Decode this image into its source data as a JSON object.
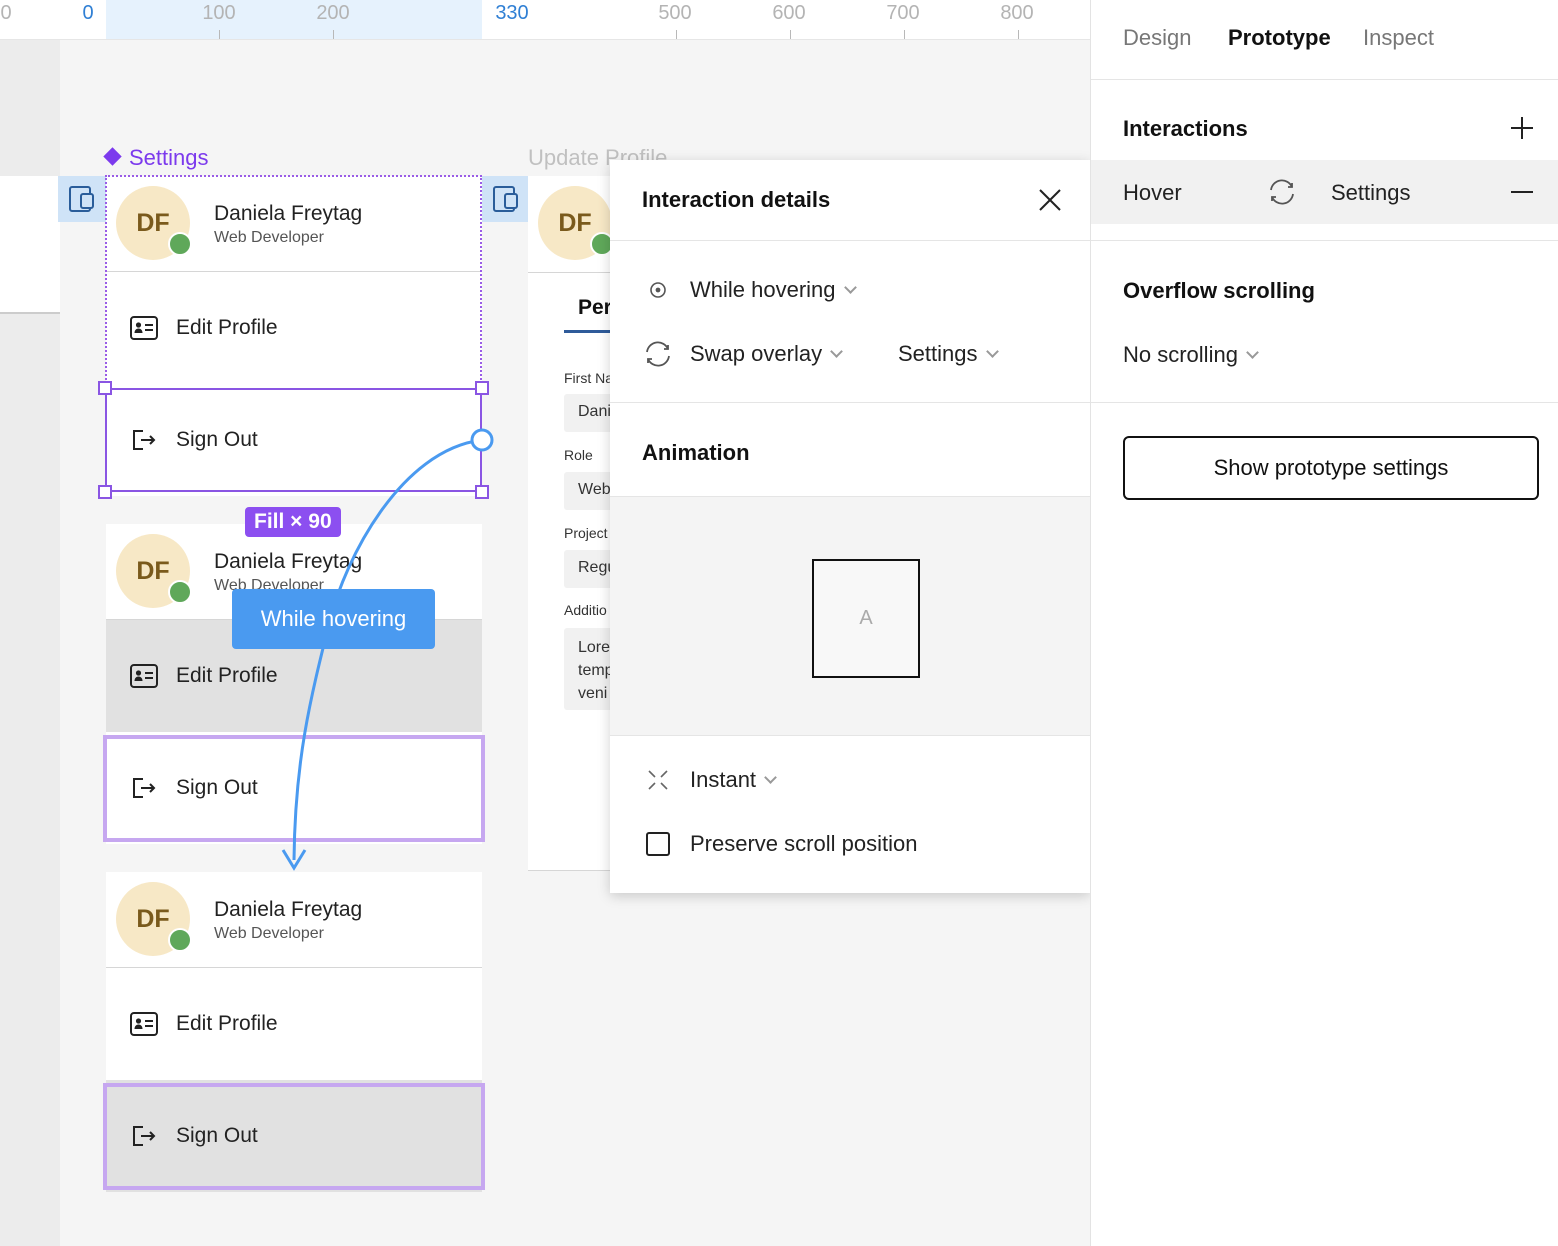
{
  "ruler": {
    "labels": [
      "0",
      "100",
      "200",
      "330",
      "500",
      "600",
      "700",
      "800"
    ],
    "selection_start": "0",
    "selection_end": "330"
  },
  "canvas": {
    "settings_frame_label": "Settings",
    "update_frame_label": "Update Profile",
    "fill_badge": "Fill × 90",
    "hover_badge": "While hovering"
  },
  "cards": [
    {
      "initials": "DF",
      "name": "Daniela Freytag",
      "role": "Web Developer",
      "edit": "Edit Profile",
      "signout": "Sign Out"
    },
    {
      "initials": "DF",
      "name": "Daniela Freytag",
      "role": "Web Developer",
      "edit": "Edit Profile",
      "signout": "Sign Out"
    },
    {
      "initials": "DF",
      "name": "Daniela Freytag",
      "role": "Web Developer",
      "edit": "Edit Profile",
      "signout": "Sign Out"
    }
  ],
  "update_profile": {
    "initials": "DF",
    "tab": "Per",
    "fields": [
      {
        "label": "First Na",
        "value": "Dani"
      },
      {
        "label": "Role",
        "value": "Web"
      },
      {
        "label": "Project",
        "value": "Regu"
      },
      {
        "label": "Additio",
        "value": ""
      }
    ],
    "textarea_lines": [
      "Lore",
      "temp",
      "veni"
    ]
  },
  "modal": {
    "title": "Interaction details",
    "trigger": "While hovering",
    "action": "Swap overlay",
    "destination": "Settings",
    "animation_title": "Animation",
    "preview_letter": "A",
    "transition": "Instant",
    "preserve_scroll": "Preserve scroll position"
  },
  "panel": {
    "tabs": [
      "Design",
      "Prototype",
      "Inspect"
    ],
    "active_tab": "Prototype",
    "interactions_title": "Interactions",
    "interaction": {
      "trigger": "Hover",
      "target": "Settings"
    },
    "overflow_title": "Overflow scrolling",
    "overflow_value": "No scrolling",
    "proto_button": "Show prototype settings"
  },
  "colors": {
    "accent_purple": "#8a55e3",
    "hover_blue": "#4a9af0",
    "avatar_bg": "#f7e8c6",
    "status_green": "#5fa85a"
  }
}
